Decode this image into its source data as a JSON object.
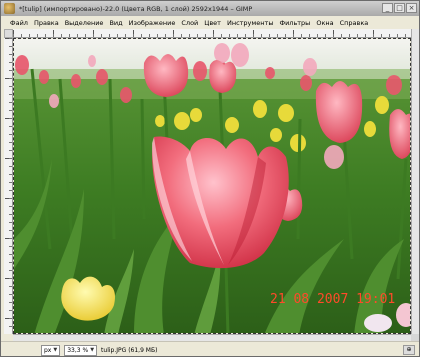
{
  "window": {
    "title": "*[tulip] (импортировано)-22.0 (Цвета RGB, 1 слой) 2592x1944 – GIMP",
    "controls": {
      "minimize": "_",
      "maximize": "□",
      "close": "×"
    }
  },
  "menu": {
    "items": [
      {
        "label": "Файл"
      },
      {
        "label": "Правка"
      },
      {
        "label": "Выделение"
      },
      {
        "label": "Вид"
      },
      {
        "label": "Изображение"
      },
      {
        "label": "Слой"
      },
      {
        "label": "Цвет"
      },
      {
        "label": "Инструменты"
      },
      {
        "label": "Фильтры"
      },
      {
        "label": "Окна"
      },
      {
        "label": "Справка"
      }
    ]
  },
  "canvas": {
    "date_stamp": "21 08 2007 19:01",
    "colors": {
      "stamp": "#ff4a2a"
    }
  },
  "statusbar": {
    "unit": "px",
    "zoom": "33,3 %",
    "file_info": "tulip.JPG (61,9 МБ)",
    "nav_button": "⊕"
  }
}
